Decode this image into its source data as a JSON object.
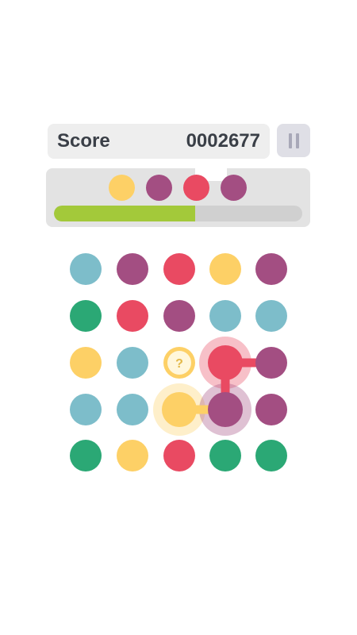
{
  "score": {
    "label": "Score",
    "value": "0002677"
  },
  "pause_button": {
    "icon": "pause-icon"
  },
  "colors": {
    "teal": "#7dbdca",
    "purple": "#a34e82",
    "red": "#e94a62",
    "yellow": "#fdd066",
    "green": "#2ba875"
  },
  "goal": {
    "dots": [
      "yellow",
      "purple",
      "red",
      "purple"
    ],
    "progress_fraction": 0.57
  },
  "board": {
    "rows": 5,
    "cols": 5,
    "grid": [
      [
        "teal",
        "purple",
        "red",
        "yellow",
        "purple"
      ],
      [
        "green",
        "red",
        "purple",
        "teal",
        "teal"
      ],
      [
        "yellow",
        "teal",
        "mystery",
        "red",
        "purple"
      ],
      [
        "teal",
        "teal",
        "yellow",
        "purple",
        "purple"
      ],
      [
        "green",
        "yellow",
        "red",
        "green",
        "green"
      ]
    ],
    "mystery_symbol": "?",
    "highlighted": [
      [
        2,
        3
      ],
      [
        3,
        2
      ],
      [
        3,
        3
      ]
    ],
    "connections": [
      {
        "from": [
          2,
          3
        ],
        "to": [
          2,
          4
        ],
        "color": "red"
      },
      {
        "from": [
          2,
          3
        ],
        "to": [
          3,
          3
        ],
        "color": "red"
      },
      {
        "from": [
          3,
          2
        ],
        "to": [
          3,
          3
        ],
        "color": "yellow"
      }
    ]
  }
}
